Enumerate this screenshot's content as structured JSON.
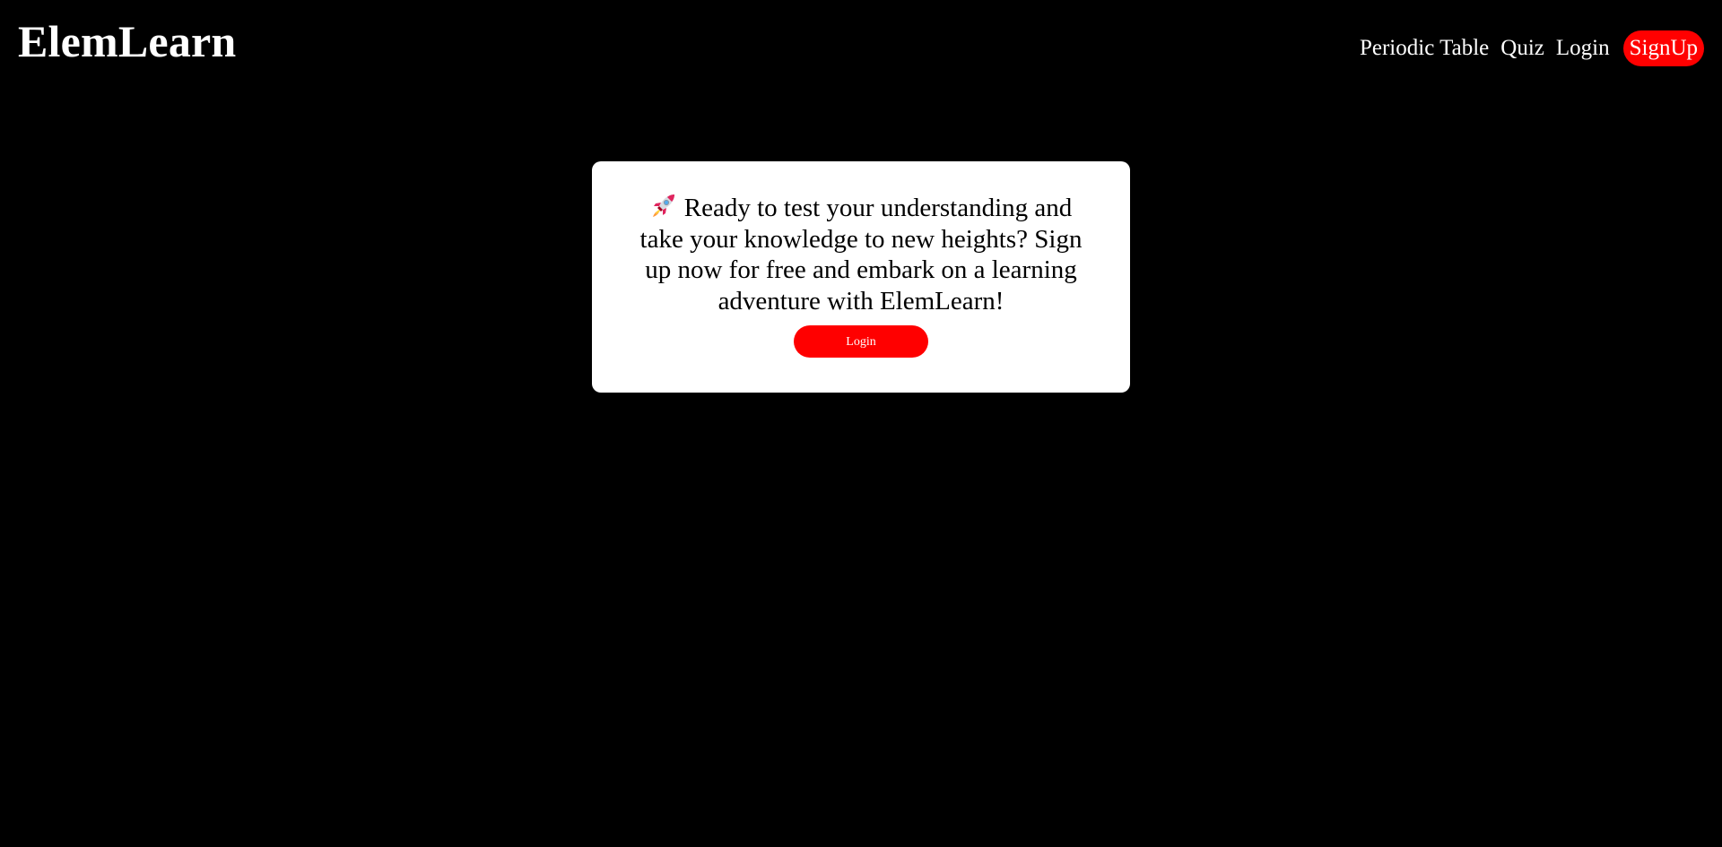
{
  "header": {
    "brand": "ElemLearn",
    "nav": {
      "periodic_table": "Periodic Table",
      "quiz": "Quiz",
      "login": "Login",
      "signup": "SignUp"
    }
  },
  "cta_card": {
    "icon": "rocket-icon",
    "message": "Ready to test your understanding and take your knowledge to new heights? Sign up now for free and embark on a learning adventure with ElemLearn!",
    "button_label": "Login"
  },
  "colors": {
    "background": "#000000",
    "accent": "#ff0000",
    "card": "#ffffff",
    "text_light": "#ffffff",
    "text_dark": "#000000"
  }
}
